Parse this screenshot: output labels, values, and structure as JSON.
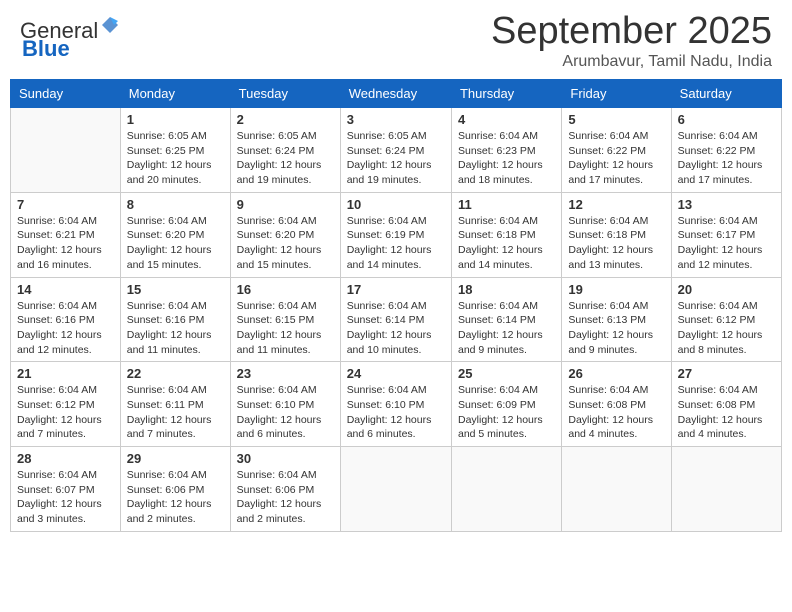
{
  "header": {
    "logo_general": "General",
    "logo_blue": "Blue",
    "month_title": "September 2025",
    "location": "Arumbavur, Tamil Nadu, India"
  },
  "days_of_week": [
    "Sunday",
    "Monday",
    "Tuesday",
    "Wednesday",
    "Thursday",
    "Friday",
    "Saturday"
  ],
  "weeks": [
    [
      {
        "day": "",
        "info": ""
      },
      {
        "day": "1",
        "info": "Sunrise: 6:05 AM\nSunset: 6:25 PM\nDaylight: 12 hours\nand 20 minutes."
      },
      {
        "day": "2",
        "info": "Sunrise: 6:05 AM\nSunset: 6:24 PM\nDaylight: 12 hours\nand 19 minutes."
      },
      {
        "day": "3",
        "info": "Sunrise: 6:05 AM\nSunset: 6:24 PM\nDaylight: 12 hours\nand 19 minutes."
      },
      {
        "day": "4",
        "info": "Sunrise: 6:04 AM\nSunset: 6:23 PM\nDaylight: 12 hours\nand 18 minutes."
      },
      {
        "day": "5",
        "info": "Sunrise: 6:04 AM\nSunset: 6:22 PM\nDaylight: 12 hours\nand 17 minutes."
      },
      {
        "day": "6",
        "info": "Sunrise: 6:04 AM\nSunset: 6:22 PM\nDaylight: 12 hours\nand 17 minutes."
      }
    ],
    [
      {
        "day": "7",
        "info": "Sunrise: 6:04 AM\nSunset: 6:21 PM\nDaylight: 12 hours\nand 16 minutes."
      },
      {
        "day": "8",
        "info": "Sunrise: 6:04 AM\nSunset: 6:20 PM\nDaylight: 12 hours\nand 15 minutes."
      },
      {
        "day": "9",
        "info": "Sunrise: 6:04 AM\nSunset: 6:20 PM\nDaylight: 12 hours\nand 15 minutes."
      },
      {
        "day": "10",
        "info": "Sunrise: 6:04 AM\nSunset: 6:19 PM\nDaylight: 12 hours\nand 14 minutes."
      },
      {
        "day": "11",
        "info": "Sunrise: 6:04 AM\nSunset: 6:18 PM\nDaylight: 12 hours\nand 14 minutes."
      },
      {
        "day": "12",
        "info": "Sunrise: 6:04 AM\nSunset: 6:18 PM\nDaylight: 12 hours\nand 13 minutes."
      },
      {
        "day": "13",
        "info": "Sunrise: 6:04 AM\nSunset: 6:17 PM\nDaylight: 12 hours\nand 12 minutes."
      }
    ],
    [
      {
        "day": "14",
        "info": "Sunrise: 6:04 AM\nSunset: 6:16 PM\nDaylight: 12 hours\nand 12 minutes."
      },
      {
        "day": "15",
        "info": "Sunrise: 6:04 AM\nSunset: 6:16 PM\nDaylight: 12 hours\nand 11 minutes."
      },
      {
        "day": "16",
        "info": "Sunrise: 6:04 AM\nSunset: 6:15 PM\nDaylight: 12 hours\nand 11 minutes."
      },
      {
        "day": "17",
        "info": "Sunrise: 6:04 AM\nSunset: 6:14 PM\nDaylight: 12 hours\nand 10 minutes."
      },
      {
        "day": "18",
        "info": "Sunrise: 6:04 AM\nSunset: 6:14 PM\nDaylight: 12 hours\nand 9 minutes."
      },
      {
        "day": "19",
        "info": "Sunrise: 6:04 AM\nSunset: 6:13 PM\nDaylight: 12 hours\nand 9 minutes."
      },
      {
        "day": "20",
        "info": "Sunrise: 6:04 AM\nSunset: 6:12 PM\nDaylight: 12 hours\nand 8 minutes."
      }
    ],
    [
      {
        "day": "21",
        "info": "Sunrise: 6:04 AM\nSunset: 6:12 PM\nDaylight: 12 hours\nand 7 minutes."
      },
      {
        "day": "22",
        "info": "Sunrise: 6:04 AM\nSunset: 6:11 PM\nDaylight: 12 hours\nand 7 minutes."
      },
      {
        "day": "23",
        "info": "Sunrise: 6:04 AM\nSunset: 6:10 PM\nDaylight: 12 hours\nand 6 minutes."
      },
      {
        "day": "24",
        "info": "Sunrise: 6:04 AM\nSunset: 6:10 PM\nDaylight: 12 hours\nand 6 minutes."
      },
      {
        "day": "25",
        "info": "Sunrise: 6:04 AM\nSunset: 6:09 PM\nDaylight: 12 hours\nand 5 minutes."
      },
      {
        "day": "26",
        "info": "Sunrise: 6:04 AM\nSunset: 6:08 PM\nDaylight: 12 hours\nand 4 minutes."
      },
      {
        "day": "27",
        "info": "Sunrise: 6:04 AM\nSunset: 6:08 PM\nDaylight: 12 hours\nand 4 minutes."
      }
    ],
    [
      {
        "day": "28",
        "info": "Sunrise: 6:04 AM\nSunset: 6:07 PM\nDaylight: 12 hours\nand 3 minutes."
      },
      {
        "day": "29",
        "info": "Sunrise: 6:04 AM\nSunset: 6:06 PM\nDaylight: 12 hours\nand 2 minutes."
      },
      {
        "day": "30",
        "info": "Sunrise: 6:04 AM\nSunset: 6:06 PM\nDaylight: 12 hours\nand 2 minutes."
      },
      {
        "day": "",
        "info": ""
      },
      {
        "day": "",
        "info": ""
      },
      {
        "day": "",
        "info": ""
      },
      {
        "day": "",
        "info": ""
      }
    ]
  ]
}
